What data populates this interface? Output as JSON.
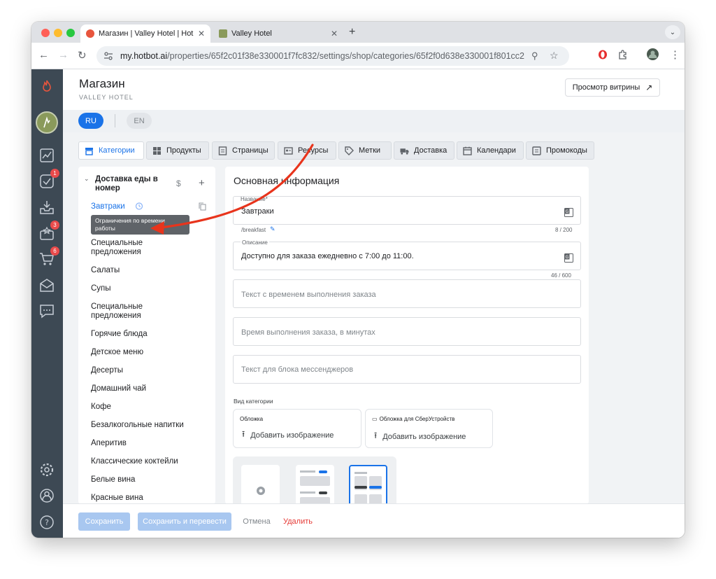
{
  "browser": {
    "tabs": [
      {
        "title": "Магазин | Valley Hotel | Hotbot",
        "active": true
      },
      {
        "title": "Valley Hotel",
        "active": false
      }
    ],
    "url_main": "my.hotbot.ai",
    "url_path": "/properties/65f2c01f38e330001f7fc832/settings/shop/categories/65f2f0d638e330001f801cc2"
  },
  "header": {
    "title": "Магазин",
    "subtitle": "VALLEY HOTEL",
    "preview_label": "Просмотр витрины"
  },
  "languages": {
    "ru": "RU",
    "en": "EN"
  },
  "sidebar": {
    "badges": {
      "tasks": "1",
      "reviews": "3",
      "orders": "6"
    }
  },
  "nav_tabs": [
    {
      "label": "Категории",
      "icon": "store-icon"
    },
    {
      "label": "Продукты",
      "icon": "grid-icon"
    },
    {
      "label": "Страницы",
      "icon": "page-icon"
    },
    {
      "label": "Ресурсы",
      "icon": "resource-icon"
    },
    {
      "label": "Метки",
      "icon": "tag-icon"
    },
    {
      "label": "Доставка",
      "icon": "truck-icon"
    },
    {
      "label": "Календари",
      "icon": "calendar-icon"
    },
    {
      "label": "Промокоды",
      "icon": "promo-icon"
    }
  ],
  "categories": {
    "group": "Доставка еды в номер",
    "group_icons": {
      "currency": "$",
      "add": "+"
    },
    "items": [
      "Завтраки",
      "Специальные предложения",
      "Салаты",
      "Супы",
      "Специальные предложения",
      "Горячие блюда",
      "Детское меню",
      "Десерты",
      "Домашний чай",
      "Кофе",
      "Безалкогольные напитки",
      "Аперитив",
      "Классические коктейли",
      "Белые вина",
      "Красные вина"
    ],
    "tooltip": "Ограничения по времени работы"
  },
  "form": {
    "section_title": "Основная информация",
    "name_label": "Название*",
    "name_value": "Завтраки",
    "slug": "/breakfast",
    "name_counter": "8 / 200",
    "desc_label": "Описание",
    "desc_value": "Доступно для заказа ежедневно с 7:00 до 11:00.",
    "desc_counter": "46 / 600",
    "placeholder_time_text": "Текст с временем выполнения заказа",
    "placeholder_time_minutes": "Время выполнения заказа, в минутах",
    "placeholder_messenger": "Текст для блока мессенджеров",
    "view_label": "Вид категории",
    "cover_label": "Обложка",
    "cover_sber_label": "Обложка для СберУстройств",
    "add_image": "Добавить изображение"
  },
  "footer": {
    "save": "Сохранить",
    "save_translate": "Сохранить и перевести",
    "cancel": "Отмена",
    "delete": "Удалить"
  },
  "colors": {
    "accent": "#1a73e8",
    "sidebar": "#3d4954",
    "danger": "#e53935",
    "arrow": "#e8341c"
  }
}
